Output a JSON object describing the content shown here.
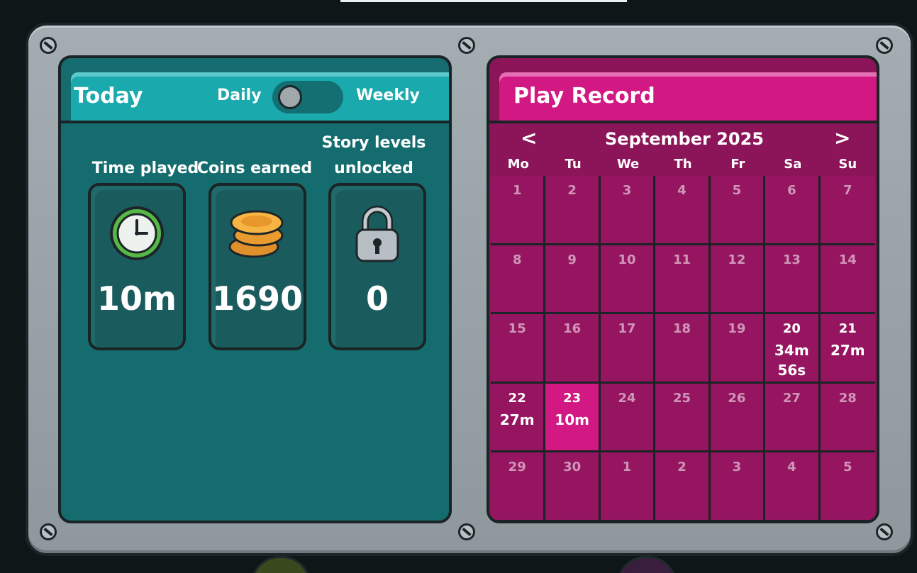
{
  "today_panel": {
    "title": "Today",
    "toggle": {
      "left_label": "Daily",
      "right_label": "Weekly",
      "selected": "Daily"
    },
    "stats": [
      {
        "label": "Time played",
        "icon": "clock-icon",
        "value": "10m"
      },
      {
        "label": "Coins earned",
        "icon": "coins-icon",
        "value": "1690"
      },
      {
        "label": "Story levels unlocked",
        "icon": "padlock-icon",
        "value": "0"
      }
    ]
  },
  "play_record": {
    "title": "Play Record",
    "prev_label": "<",
    "next_label": ">",
    "month": "September 2025",
    "weekdays": [
      "Mo",
      "Tu",
      "We",
      "Th",
      "Fr",
      "Sa",
      "Su"
    ],
    "weeks": [
      [
        {
          "day": "1",
          "time": ""
        },
        {
          "day": "2",
          "time": ""
        },
        {
          "day": "3",
          "time": ""
        },
        {
          "day": "4",
          "time": ""
        },
        {
          "day": "5",
          "time": ""
        },
        {
          "day": "6",
          "time": ""
        },
        {
          "day": "7",
          "time": ""
        }
      ],
      [
        {
          "day": "8",
          "time": ""
        },
        {
          "day": "9",
          "time": ""
        },
        {
          "day": "10",
          "time": ""
        },
        {
          "day": "11",
          "time": ""
        },
        {
          "day": "12",
          "time": ""
        },
        {
          "day": "13",
          "time": ""
        },
        {
          "day": "14",
          "time": ""
        }
      ],
      [
        {
          "day": "15",
          "time": ""
        },
        {
          "day": "16",
          "time": ""
        },
        {
          "day": "17",
          "time": ""
        },
        {
          "day": "18",
          "time": ""
        },
        {
          "day": "19",
          "time": ""
        },
        {
          "day": "20",
          "time": "34m\n56s"
        },
        {
          "day": "21",
          "time": "27m"
        }
      ],
      [
        {
          "day": "22",
          "time": "27m"
        },
        {
          "day": "23",
          "time": "10m",
          "today": true
        },
        {
          "day": "24",
          "time": ""
        },
        {
          "day": "25",
          "time": ""
        },
        {
          "day": "26",
          "time": ""
        },
        {
          "day": "27",
          "time": ""
        },
        {
          "day": "28",
          "time": ""
        }
      ],
      [
        {
          "day": "29",
          "time": ""
        },
        {
          "day": "30",
          "time": ""
        },
        {
          "day": "1",
          "time": ""
        },
        {
          "day": "2",
          "time": ""
        },
        {
          "day": "3",
          "time": ""
        },
        {
          "day": "4",
          "time": ""
        },
        {
          "day": "5",
          "time": ""
        }
      ]
    ]
  },
  "colors": {
    "teal_panel": "#156c6e",
    "teal_header": "#1aa9ad",
    "magenta_panel": "#961560",
    "magenta_header": "#d21882",
    "frame": "#9aa4a9"
  }
}
